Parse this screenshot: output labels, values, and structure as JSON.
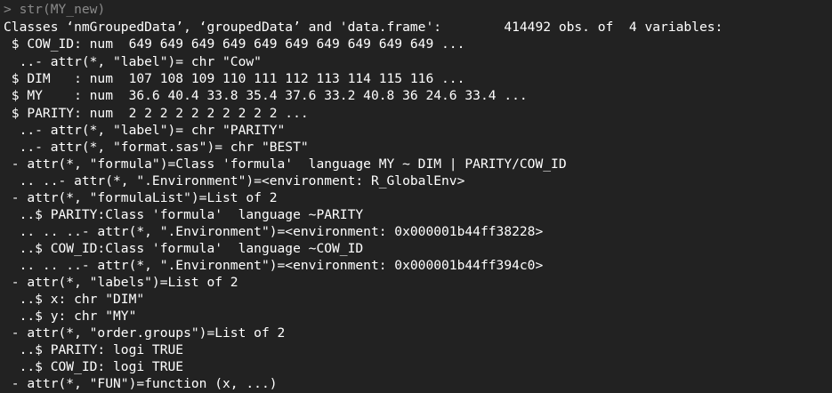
{
  "console": {
    "prompt": ">",
    "command": " str(MY_new)",
    "output_lines": [
      "Classes ‘nmGroupedData’, ‘groupedData’ and 'data.frame':        414492 obs. of  4 variables:",
      " $ COW_ID: num  649 649 649 649 649 649 649 649 649 649 ...",
      "  ..- attr(*, \"label\")= chr \"Cow\"",
      " $ DIM   : num  107 108 109 110 111 112 113 114 115 116 ...",
      " $ MY    : num  36.6 40.4 33.8 35.4 37.6 33.2 40.8 36 24.6 33.4 ...",
      " $ PARITY: num  2 2 2 2 2 2 2 2 2 2 ...",
      "  ..- attr(*, \"label\")= chr \"PARITY\"",
      "  ..- attr(*, \"format.sas\")= chr \"BEST\"",
      " - attr(*, \"formula\")=Class 'formula'  language MY ~ DIM | PARITY/COW_ID",
      "  .. ..- attr(*, \".Environment\")=<environment: R_GlobalEnv>",
      " - attr(*, \"formulaList\")=List of 2",
      "  ..$ PARITY:Class 'formula'  language ~PARITY",
      "  .. .. ..- attr(*, \".Environment\")=<environment: 0x000001b44ff38228>",
      "  ..$ COW_ID:Class 'formula'  language ~COW_ID",
      "  .. .. ..- attr(*, \".Environment\")=<environment: 0x000001b44ff394c0>",
      " - attr(*, \"labels\")=List of 2",
      "  ..$ x: chr \"DIM\"",
      "  ..$ y: chr \"MY\"",
      " - attr(*, \"order.groups\")=List of 2",
      "  ..$ PARITY: logi TRUE",
      "  ..$ COW_ID: logi TRUE",
      " - attr(*, \"FUN\")=function (x, ...)"
    ]
  }
}
